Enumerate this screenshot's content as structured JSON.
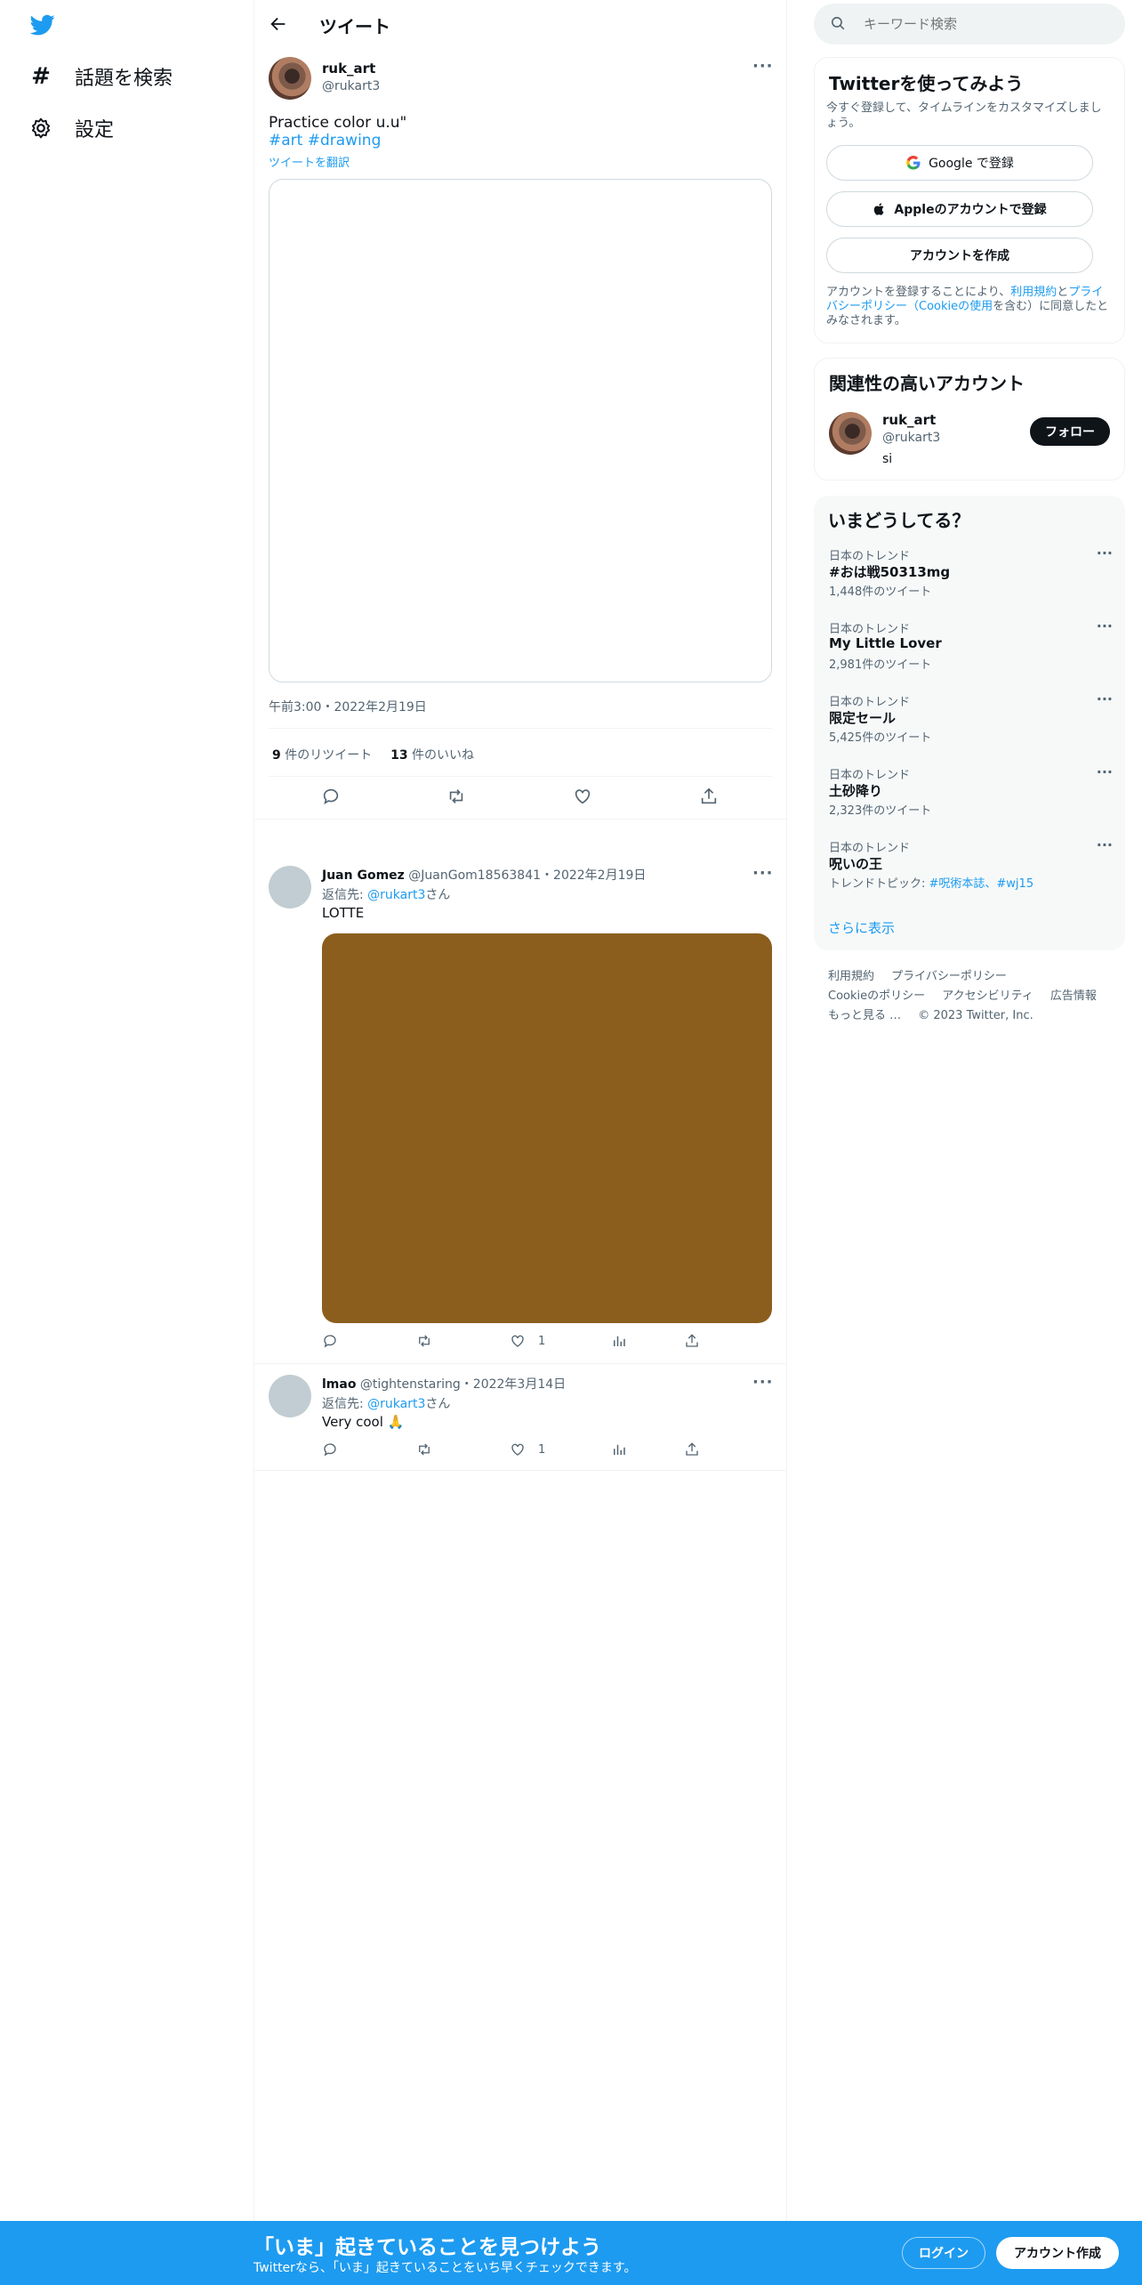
{
  "nav": {
    "explore_label": "話題を検索",
    "settings_label": "設定"
  },
  "header": {
    "title": "ツイート"
  },
  "tweet": {
    "display_name": "ruk_art",
    "handle": "@rukart3",
    "text": "Practice color u.u\"",
    "hashtags": [
      "#art",
      "#drawing"
    ],
    "translate": "ツイートを翻訳",
    "timestamp": "午前3:00・2022年2月19日",
    "retweets_count": "9",
    "retweets_label": "件のリツイート",
    "likes_count": "13",
    "likes_label": "件のいいね"
  },
  "replies": [
    {
      "display_name": "Juan Gomez",
      "handle": "@JuanGom18563841",
      "date": "・2022年2月19日",
      "reply_prefix": "返信先: ",
      "reply_to": "@rukart3",
      "reply_suffix": "さん",
      "text": "LOTTE",
      "image_color": "#8b5e1e",
      "like_count": "1"
    },
    {
      "display_name": "lmao",
      "handle": "@tightenstaring",
      "date": "・2022年3月14日",
      "reply_prefix": "返信先: ",
      "reply_to": "@rukart3",
      "reply_suffix": "さん",
      "text": "Very cool 🙏",
      "like_count": "1"
    }
  ],
  "search": {
    "placeholder": "キーワード検索"
  },
  "signup": {
    "title": "Twitterを使ってみよう",
    "subtitle": "今すぐ登録して、タイムラインをカスタマイズしましょう。",
    "google_btn": "Google で登録",
    "apple_btn": "Appleのアカウントで登録",
    "create_btn": "アカウントを作成",
    "legal_prefix": "アカウントを登録することにより、",
    "legal_terms": "利用規約",
    "legal_and": "と",
    "legal_privacy": "プライバシーポリシー（Cookieの使用",
    "legal_suffix": "を含む）に同意したとみなされます。"
  },
  "related": {
    "title": "関連性の高いアカウント",
    "display_name": "ruk_art",
    "handle": "@rukart3",
    "bio": "si",
    "follow_btn": "フォロー"
  },
  "trends": {
    "title": "いまどうしてる？",
    "items": [
      {
        "category": "日本のトレンド",
        "name": "#おは戦50313mg",
        "count": "1,448件のツイート"
      },
      {
        "category": "日本のトレンド",
        "name": "My Little Lover",
        "count": "2,981件のツイート"
      },
      {
        "category": "日本のトレンド",
        "name": "限定セール",
        "count": "5,425件のツイート"
      },
      {
        "category": "日本のトレンド",
        "name": "土砂降り",
        "count": "2,323件のツイート"
      },
      {
        "category": "日本のトレンド",
        "name": "呪いの王",
        "topic_prefix": "トレンドトピック: ",
        "topics": "#呪術本誌、#wj15"
      }
    ],
    "show_more": "さらに表示"
  },
  "footer": {
    "links": [
      "利用規約",
      "プライバシーポリシー",
      "Cookieのポリシー",
      "アクセシビリティ",
      "広告情報",
      "もっと見る …"
    ],
    "copyright": "© 2023 Twitter, Inc."
  },
  "bottom_bar": {
    "headline": "「いま」起きていることを見つけよう",
    "subline": "Twitterなら、「いま」起きていることをいち早くチェックできます。",
    "login_btn": "ログイン",
    "signup_btn": "アカウント作成"
  },
  "colors": {
    "brand": "#1d9bf0",
    "text": "#0f1419",
    "muted": "#536471"
  }
}
